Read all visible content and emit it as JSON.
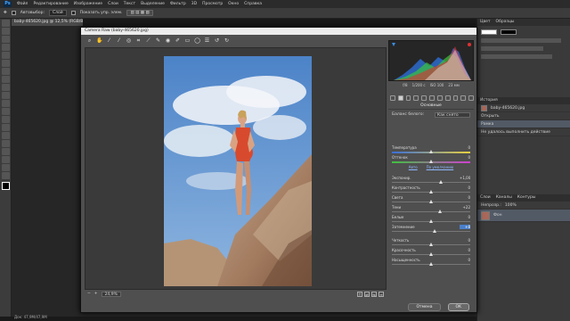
{
  "menubar": {
    "logo": "Ps",
    "items": [
      "Файл",
      "Редактирование",
      "Изображение",
      "Слои",
      "Текст",
      "Выделение",
      "Фильтр",
      "3D",
      "Просмотр",
      "Окно",
      "Справка"
    ]
  },
  "optionsbar": {
    "autoselect_label": "Автовыбор:",
    "autoselect_value": "Слой",
    "transform_label": "Показать упр. элем."
  },
  "document": {
    "tab_title": "baby-465620.jpg @ 12,5% (RGB/8#)",
    "status": "Док: 47,9М/47,9М"
  },
  "right_panel": {
    "top_tabs": [
      "Цвет",
      "Образцы"
    ],
    "history_title": "История",
    "history_items": [
      "baby-465620.jpg",
      "Открыть",
      "Рамка",
      "Не удалось выполнить действие"
    ],
    "layers_tabs": [
      "Слои",
      "Каналы",
      "Контуры"
    ],
    "layer_name": "Фон",
    "opacity_label": "Непрозр.:",
    "opacity_value": "100%"
  },
  "dialog": {
    "title": "Camera Raw (baby-465620.jpg)",
    "zoom": "24,9%",
    "camera_info": [
      "f/8",
      "1/200 с",
      "ISO 100",
      "23 мм"
    ],
    "panel_title": "Основные",
    "wb_label": "Баланс белого:",
    "wb_value": "Как снято",
    "auto_link": "Авто",
    "default_link": "По умолчанию",
    "cancel": "Отмена",
    "ok": "OK",
    "sliders_top": [
      {
        "label": "Температура",
        "value": "0",
        "pos": 0.5,
        "kind": "temp"
      },
      {
        "label": "Оттенок",
        "value": "0",
        "pos": 0.5,
        "kind": "tint"
      }
    ],
    "sliders_mid": [
      {
        "label": "Экспонир.",
        "value": "+1,00",
        "pos": 0.62
      },
      {
        "label": "Контрастность",
        "value": "0",
        "pos": 0.5
      },
      {
        "label": "Света",
        "value": "0",
        "pos": 0.5
      },
      {
        "label": "Тени",
        "value": "+22",
        "pos": 0.61
      },
      {
        "label": "Белые",
        "value": "0",
        "pos": 0.5
      },
      {
        "label": "Затемнение",
        "value": "+8",
        "pos": 0.54,
        "active": true
      }
    ],
    "sliders_bottom": [
      {
        "label": "Четкость",
        "value": "0",
        "pos": 0.5
      },
      {
        "label": "Красочность",
        "value": "0",
        "pos": 0.5
      },
      {
        "label": "Насыщенность",
        "value": "0",
        "pos": 0.5
      }
    ]
  },
  "colors": {
    "sky": "#5f91cf",
    "rock": "#a77f63",
    "swimsuit": "#d84a2e"
  }
}
